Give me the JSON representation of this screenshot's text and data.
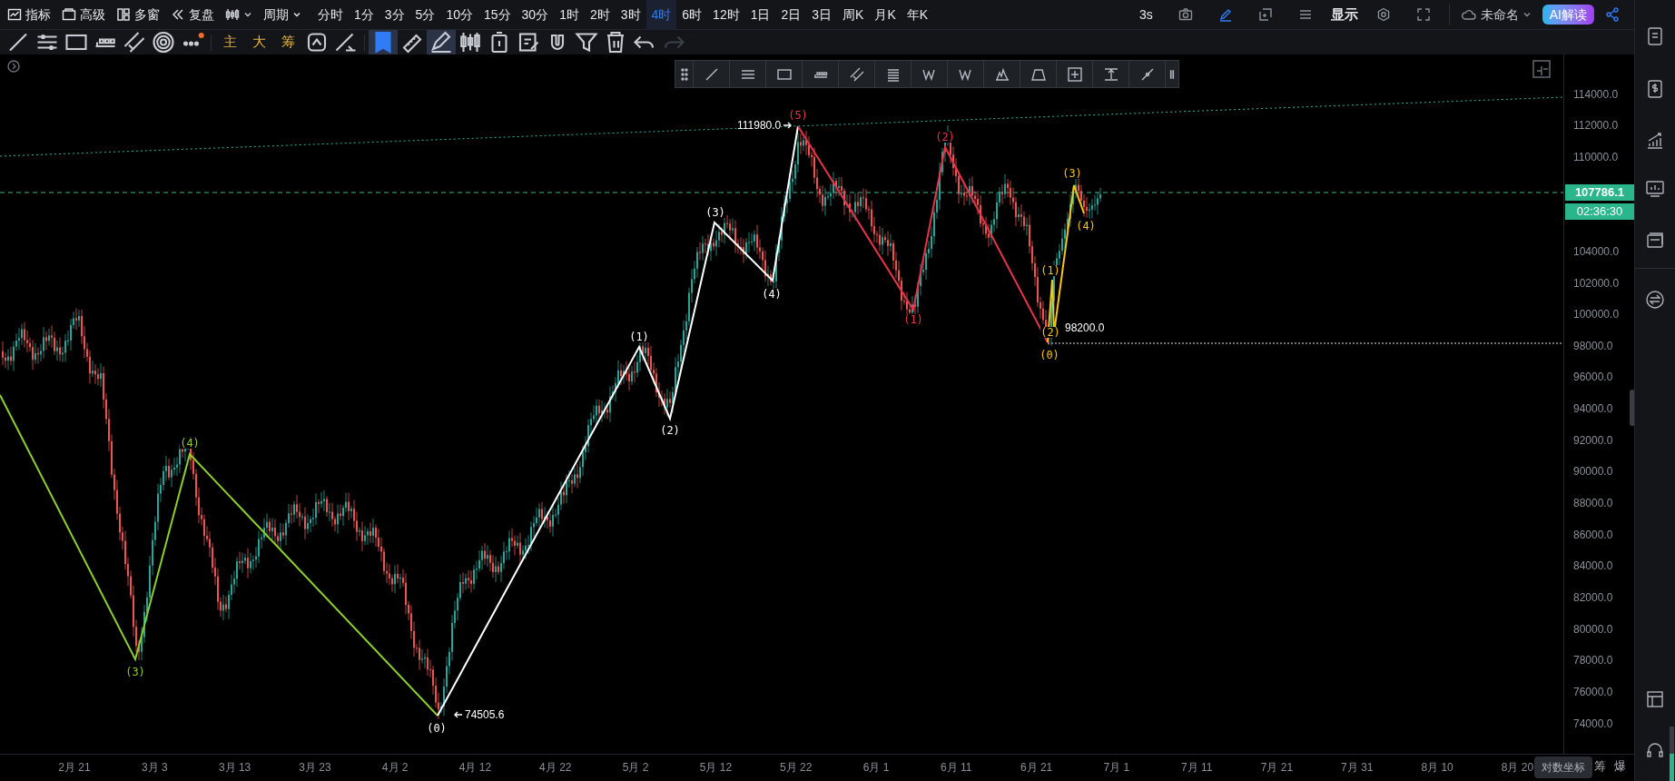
{
  "menu": [
    "指标",
    "高级",
    "多窗",
    "复盘"
  ],
  "period_label": "周期",
  "periods": [
    {
      "label": "分时",
      "selected": false
    },
    {
      "label": "1分",
      "selected": false
    },
    {
      "label": "3分",
      "selected": false
    },
    {
      "label": "5分",
      "selected": false
    },
    {
      "label": "10分",
      "selected": false
    },
    {
      "label": "15分",
      "selected": false
    },
    {
      "label": "30分",
      "selected": false
    },
    {
      "label": "1时",
      "selected": false
    },
    {
      "label": "2时",
      "selected": false
    },
    {
      "label": "3时",
      "selected": false
    },
    {
      "label": "4时",
      "selected": true
    },
    {
      "label": "6时",
      "selected": false
    },
    {
      "label": "12时",
      "selected": false
    },
    {
      "label": "1日",
      "selected": false
    },
    {
      "label": "2日",
      "selected": false
    },
    {
      "label": "3日",
      "selected": false
    },
    {
      "label": "周K",
      "selected": false
    },
    {
      "label": "月K",
      "selected": false
    },
    {
      "label": "年K",
      "selected": false
    }
  ],
  "top_right": {
    "refresh": "3s",
    "display": "显示",
    "layout_name": "未命名",
    "ai_button": "AI解读"
  },
  "toolbar": [
    {
      "kind": "icon",
      "selected": false,
      "disabled": false
    },
    {
      "kind": "icon",
      "selected": false,
      "disabled": false
    },
    {
      "kind": "icon",
      "selected": false,
      "disabled": false
    },
    {
      "kind": "icon",
      "selected": false,
      "disabled": false
    },
    {
      "kind": "icon",
      "selected": false,
      "disabled": false
    },
    {
      "kind": "icon",
      "selected": false,
      "disabled": false
    },
    {
      "kind": "icon",
      "selected": false,
      "disabled": false
    },
    {
      "kind": "text",
      "label": "主",
      "selected": false,
      "disabled": false
    },
    {
      "kind": "text",
      "label": "大",
      "selected": false,
      "disabled": false
    },
    {
      "kind": "text",
      "label": "筹",
      "selected": false,
      "disabled": false
    },
    {
      "kind": "icon",
      "selected": false,
      "disabled": false
    },
    {
      "kind": "icon",
      "selected": false,
      "disabled": false
    },
    {
      "kind": "icon",
      "selected": true,
      "disabled": false
    },
    {
      "kind": "icon",
      "selected": false,
      "disabled": false
    },
    {
      "kind": "icon",
      "selected": true,
      "disabled": false
    },
    {
      "kind": "icon",
      "selected": false,
      "disabled": false
    },
    {
      "kind": "icon",
      "selected": false,
      "disabled": false
    },
    {
      "kind": "icon",
      "selected": false,
      "disabled": false
    },
    {
      "kind": "icon",
      "selected": false,
      "disabled": false
    },
    {
      "kind": "icon",
      "selected": false,
      "disabled": false
    },
    {
      "kind": "icon",
      "selected": false,
      "disabled": false
    },
    {
      "kind": "icon",
      "selected": false,
      "disabled": false
    },
    {
      "kind": "icon",
      "selected": false,
      "disabled": true
    }
  ],
  "waves": [
    {
      "color": "#8ccf2a",
      "labels": [
        "(3)",
        "(4)"
      ]
    },
    {
      "color": "#ffffff",
      "labels": [
        "(0)",
        "(1)",
        "(2)",
        "(3)",
        "(4)"
      ]
    },
    {
      "color": "#e8334a",
      "labels": [
        "(5)",
        "(1)",
        "(2)"
      ]
    },
    {
      "color": "#f5c518",
      "labels": [
        "(3)",
        "(4)",
        "(1)",
        "(2)",
        "(0)"
      ]
    }
  ],
  "price_marks": [
    "111980.0",
    "74505.6",
    "98200.0"
  ],
  "price_axis": [
    "114000.0",
    "112000.0",
    "110000.0",
    "104000.0",
    "102000.0",
    "100000.0",
    "98000.0",
    "96000.0",
    "94000.0",
    "92000.0",
    "90000.0",
    "88000.0",
    "86000.0",
    "84000.0",
    "82000.0",
    "80000.0",
    "78000.0",
    "76000.0",
    "74000.0"
  ],
  "current_price": "107786.1",
  "countdown": "02:36:30",
  "time_axis": [
    "2月 21",
    "3月 3",
    "3月 13",
    "3月 23",
    "4月 2",
    "4月 12",
    "4月 22",
    "5月 2",
    "5月 12",
    "5月 22",
    "6月 1",
    "6月 11",
    "6月 21",
    "7月 1",
    "7月 11",
    "7月 21",
    "7月 31",
    "8月 10",
    "8月 20"
  ],
  "axis_tooltip": "对数坐标",
  "axis_buttons": [
    "筹",
    "爆"
  ]
}
